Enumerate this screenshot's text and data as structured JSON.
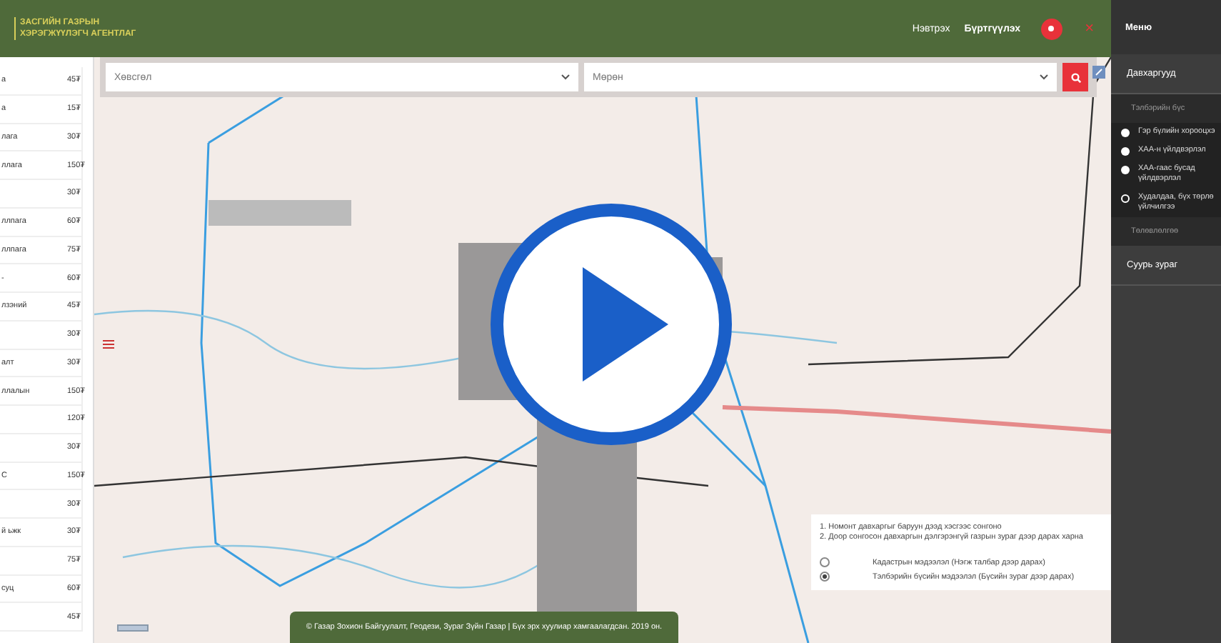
{
  "header": {
    "logo_lines": [
      "ЗАСГИЙН ГАЗРЫН",
      "ХЭРЭГЖҮҮЛЭГЧ АГЕНТЛАГ"
    ],
    "links": [
      "Нэвтрэх",
      "Бүртгүүлэх"
    ],
    "close": "×"
  },
  "price_table": {
    "rows": [
      {
        "name": "а",
        "price": "45₮"
      },
      {
        "name": "а",
        "price": "15₮"
      },
      {
        "name": "лага",
        "price": "30₮"
      },
      {
        "name": "ллага",
        "price": "150₮"
      },
      {
        "name": "",
        "price": "30₮"
      },
      {
        "name": "ллпага",
        "price": "60₮"
      },
      {
        "name": "ллпага",
        "price": "75₮"
      },
      {
        "name": "-",
        "price": "60₮"
      },
      {
        "name": "лзэний",
        "price": "45₮"
      },
      {
        "name": "",
        "price": "30₮"
      },
      {
        "name": "алт",
        "price": "30₮"
      },
      {
        "name": "ллалын",
        "price": "150₮"
      },
      {
        "name": "",
        "price": "120₮"
      },
      {
        "name": "",
        "price": "30₮"
      },
      {
        "name": "С",
        "price": "150₮"
      },
      {
        "name": "",
        "price": "30₮"
      },
      {
        "name": "й ьжк",
        "price": "30₮"
      },
      {
        "name": "",
        "price": "75₮"
      },
      {
        "name": "суц",
        "price": "60₮"
      },
      {
        "name": "",
        "price": "45₮"
      }
    ]
  },
  "filters": [
    {
      "value": "Хөвсгөл"
    },
    {
      "value": "Мөрөн"
    }
  ],
  "legend": {
    "notes": [
      "1. Номонт давхаргыг баруун дээд хэсгээс сонгоно",
      "2. Доор сонгосон давхаргын дэлгэрэнгүй газрын зураг дээр дарах харна"
    ],
    "options": [
      {
        "label": "Кадастрын мэдээлэл (Нэгж талбар дээр дарах)",
        "selected": false
      },
      {
        "label": "Тэлбэрийн бүсийн мэдээлэл (Бүсийн зураг дээр дарах)",
        "selected": true
      }
    ]
  },
  "footer": "© Газар Зохион Байгуулалт, Геодези, Зураг Зүйн Газар | Бүх эрх хуулиар хамгаалагдсан. 2019 он.",
  "sidebar": {
    "title": "Меню",
    "sections": [
      {
        "label": "Давхаргууд",
        "expanded": true,
        "groups": [
          {
            "label": "Тэлбэрийн бүс",
            "items": [
              {
                "label": "Гэр бүлийн хорооцхэ",
                "selected": false
              },
              {
                "label": "ХАА-н үйлдвэрлэл",
                "selected": false
              },
              {
                "label": "ХАА-гаас бусад үйлдвэрлэл",
                "selected": false
              },
              {
                "label": "Худалдаа, бүх төрлө үйлчилгээ",
                "selected": true
              }
            ]
          },
          {
            "label": "Төлөвлөлгөө"
          }
        ]
      },
      {
        "label": "Суурь зураг",
        "expanded": false
      }
    ]
  }
}
